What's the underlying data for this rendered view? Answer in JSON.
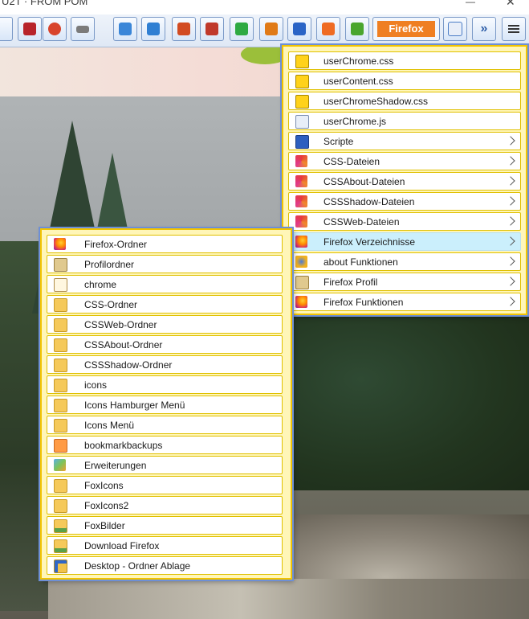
{
  "window": {
    "title_fragment": "U2T · FROM POM"
  },
  "toolbar": {
    "buttons": [
      {
        "name": "ublock-icon",
        "color": "#b8242a"
      },
      {
        "name": "addon-red-icon",
        "color": "#d8442c"
      },
      {
        "name": "sneaker-icon",
        "color": "#7b7b7b"
      },
      {
        "name": "screenshot-icon",
        "color": "#3a86d8"
      },
      {
        "name": "folder-icon",
        "color": "#2f7fd3"
      },
      {
        "name": "tools-icon",
        "color": "#d24b22"
      },
      {
        "name": "cj-icon",
        "color": "#c0392b"
      },
      {
        "name": "new-window-icon",
        "color": "#2eaa43"
      },
      {
        "name": "search-page-icon",
        "color": "#e07a17"
      },
      {
        "name": "sort-az-icon",
        "color": "#2a64c6"
      },
      {
        "name": "reload-icon",
        "color": "#ef6b23"
      },
      {
        "name": "puzzle-icon",
        "color": "#4aa52e"
      }
    ],
    "firefox_label": "Firefox",
    "spellcheck_icon": "spellcheck-icon",
    "overflow_icon": "chevrons-right-icon",
    "menu_icon": "hamburger-icon"
  },
  "firefox_menu": {
    "items": [
      {
        "label": "userChrome.css",
        "icon": "css-file-icon",
        "submenu": false,
        "active": false
      },
      {
        "label": "userContent.css",
        "icon": "css-file-icon",
        "submenu": false,
        "active": false
      },
      {
        "label": "userChromeShadow.css",
        "icon": "css-file-icon",
        "submenu": false,
        "active": false
      },
      {
        "label": "userChrome.js",
        "icon": "js-file-icon",
        "submenu": false,
        "active": false
      },
      {
        "label": "Scripte",
        "icon": "monitor-icon",
        "submenu": true,
        "active": false
      },
      {
        "label": "CSS-Dateien",
        "icon": "css-swirl-icon",
        "submenu": true,
        "active": false
      },
      {
        "label": "CSSAbout-Dateien",
        "icon": "css-swirl-icon",
        "submenu": true,
        "active": false
      },
      {
        "label": "CSSShadow-Dateien",
        "icon": "css-swirl-icon",
        "submenu": true,
        "active": false
      },
      {
        "label": "CSSWeb-Dateien",
        "icon": "css-swirl-icon",
        "submenu": true,
        "active": false
      },
      {
        "label": "Firefox Verzeichnisse",
        "icon": "firefox-icon",
        "submenu": true,
        "active": true
      },
      {
        "label": "about Funktionen",
        "icon": "gear-icon",
        "submenu": true,
        "active": false
      },
      {
        "label": "Firefox Profil",
        "icon": "profile-icon",
        "submenu": true,
        "active": false
      },
      {
        "label": "Firefox Funktionen",
        "icon": "firefox-icon",
        "submenu": true,
        "active": false
      }
    ]
  },
  "folders_menu": {
    "items": [
      {
        "label": "Firefox-Ordner",
        "icon": "firefox-icon"
      },
      {
        "label": "Profilordner",
        "icon": "profile-icon"
      },
      {
        "label": "chrome",
        "icon": "document-icon"
      },
      {
        "label": "CSS-Ordner",
        "icon": "css-folder-icon"
      },
      {
        "label": "CSSWeb-Ordner",
        "icon": "css-folder-icon"
      },
      {
        "label": "CSSAbout-Ordner",
        "icon": "css-folder-icon"
      },
      {
        "label": "CSSShadow-Ordner",
        "icon": "css-folder-icon"
      },
      {
        "label": "icons",
        "icon": "folder-icon"
      },
      {
        "label": "Icons Hamburger Menü",
        "icon": "folder-icon"
      },
      {
        "label": "Icons Menü",
        "icon": "folder-icon"
      },
      {
        "label": "bookmarkbackups",
        "icon": "copy-icon"
      },
      {
        "label": "Erweiterungen",
        "icon": "cubes-icon"
      },
      {
        "label": "FoxIcons",
        "icon": "folder-add-icon"
      },
      {
        "label": "FoxIcons2",
        "icon": "folder-add-icon"
      },
      {
        "label": "FoxBilder",
        "icon": "picture-folder-icon"
      },
      {
        "label": "Download Firefox",
        "icon": "download-folder-icon"
      },
      {
        "label": "Desktop - Ordner Ablage",
        "icon": "desktop-icon"
      }
    ]
  }
}
